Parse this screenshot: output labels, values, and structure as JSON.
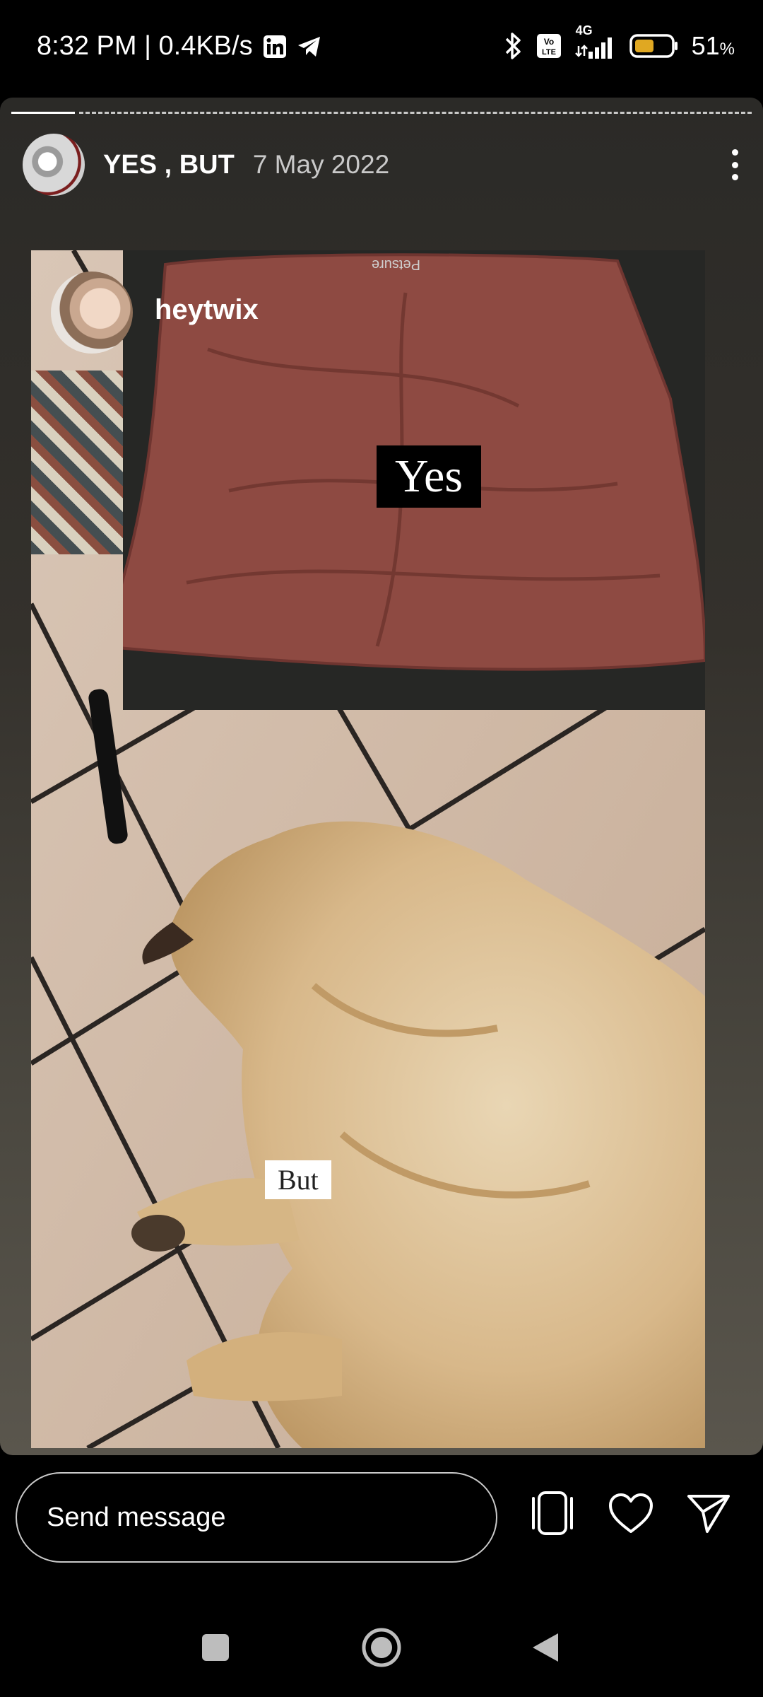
{
  "status_bar": {
    "time_speed": "8:32 PM | 0.4KB/s",
    "network": "4G",
    "volte": "Vo LTE",
    "battery": "51",
    "battery_unit": "%",
    "icons": [
      "linkedin-icon",
      "telegram-icon",
      "bluetooth-icon",
      "volte-icon",
      "signal-icon",
      "battery-icon"
    ]
  },
  "story": {
    "title": "YES , BUT",
    "date": "7 May 2022",
    "progress": {
      "segments": 2,
      "current": 1
    },
    "overlay_username": "heytwix",
    "tag_top": "Yes",
    "tag_bottom": "But",
    "bed_brand": "Petsure"
  },
  "reply_bar": {
    "placeholder": "Send message",
    "actions": [
      "tagged-icon",
      "heart-icon",
      "send-icon"
    ]
  },
  "nav_bar": {
    "buttons": [
      "recents-button",
      "home-button",
      "back-button"
    ]
  },
  "colors": {
    "background": "#000000",
    "story_bg_top": "#2b2a27",
    "story_bg_bottom": "#5a564d",
    "battery_fill": "#e0a822"
  }
}
